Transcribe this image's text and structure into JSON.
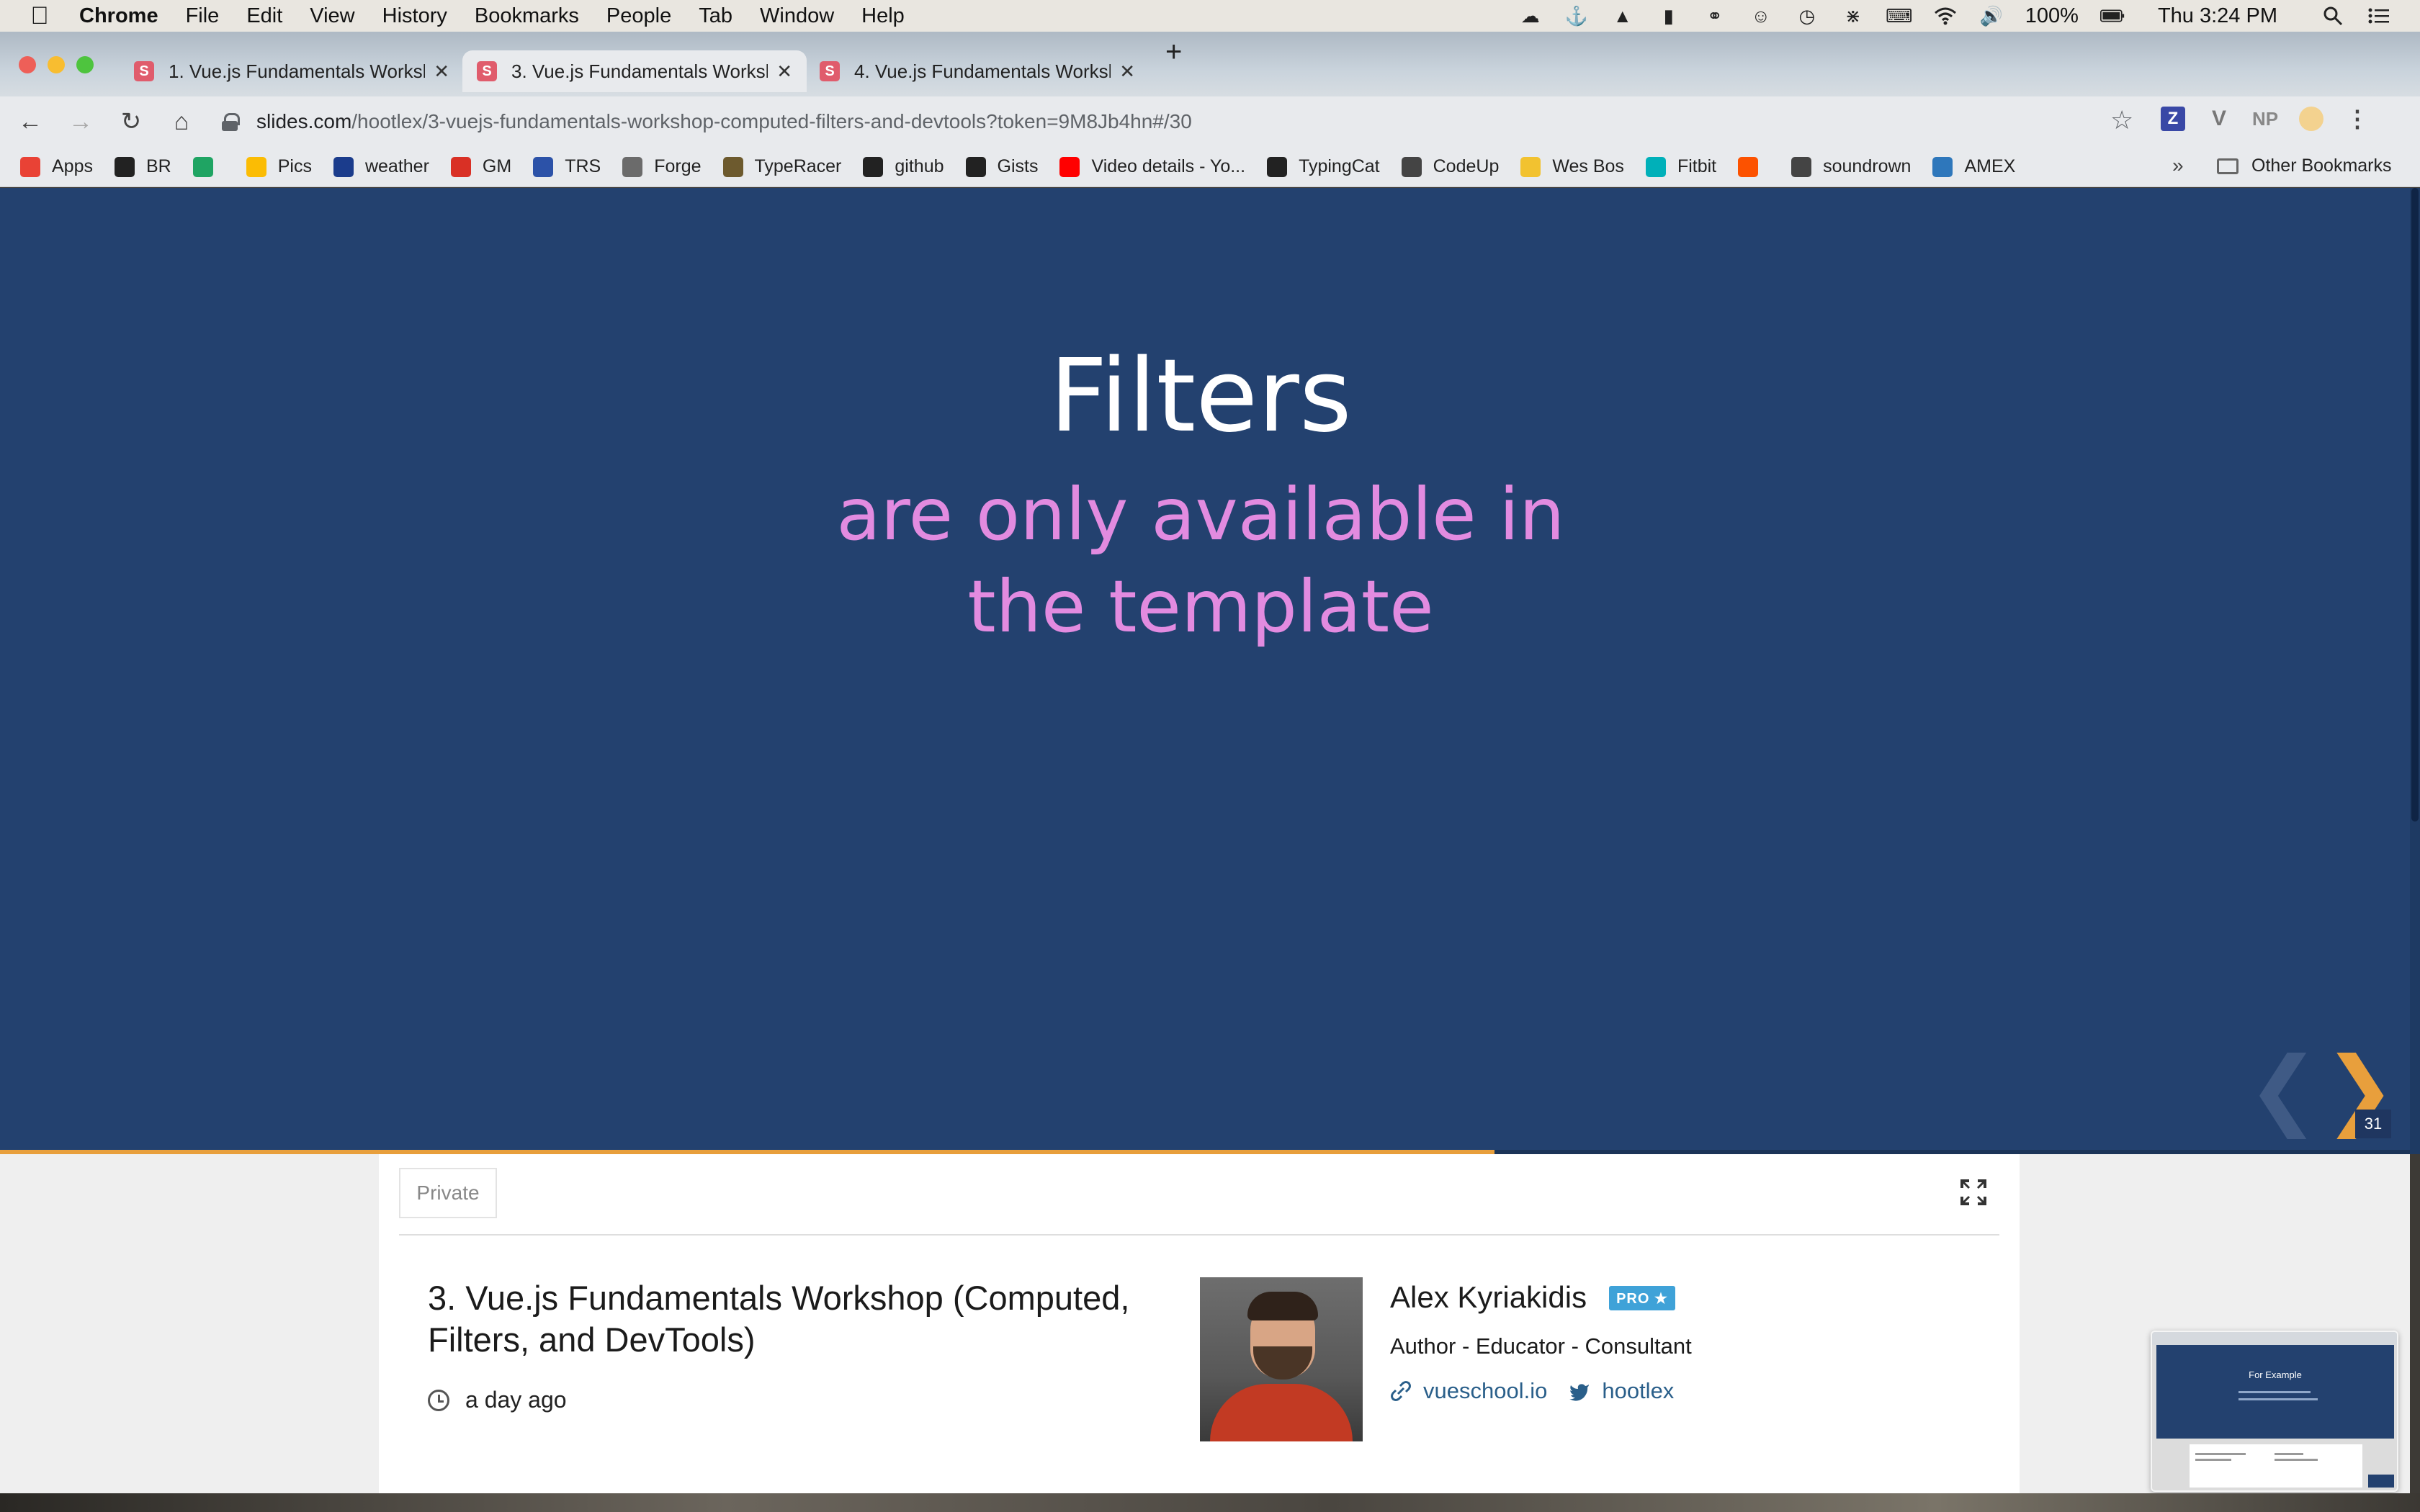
{
  "menubar": {
    "app_name": "Chrome",
    "items": [
      "File",
      "Edit",
      "View",
      "History",
      "Bookmarks",
      "People",
      "Tab",
      "Window",
      "Help"
    ],
    "battery": "100%",
    "clock": "Thu 3:24 PM",
    "status_icons": [
      "creative-cloud-icon",
      "docker-icon",
      "vectorworks-icon",
      "istat-icon",
      "glasses-icon",
      "accessibility-icon",
      "time-machine-icon",
      "bluetooth-icon",
      "keyboard-icon",
      "wifi-icon",
      "volume-icon"
    ]
  },
  "tabs": [
    {
      "title": "1. Vue.js Fundamentals Worksh",
      "active": false
    },
    {
      "title": "3. Vue.js Fundamentals Worksh",
      "active": true
    },
    {
      "title": "4. Vue.js Fundamentals Worksh",
      "active": false
    }
  ],
  "toolbar": {
    "url_host": "slides.com",
    "url_path": "/hootlex/3-vuejs-fundamentals-workshop-computed-filters-and-devtools?token=9M8Jb4hn#/30"
  },
  "extensions": {
    "z_label": "Z",
    "v_label": "V",
    "np_label": "NP"
  },
  "bookmarks": {
    "items": [
      {
        "label": "Apps",
        "icon": "apps-grid-icon",
        "color": "#e94235"
      },
      {
        "label": "BR",
        "icon": "github-icon",
        "color": "#222222"
      },
      {
        "label": "",
        "icon": "google-drive-icon",
        "color": "#1fa463"
      },
      {
        "label": "Pics",
        "icon": "google-photos-icon",
        "color": "#fbbc04"
      },
      {
        "label": "weather",
        "icon": "weather-channel-icon",
        "color": "#1b3c8c"
      },
      {
        "label": "GM",
        "icon": "gmail-icon",
        "color": "#d93025"
      },
      {
        "label": "TRS",
        "icon": "trs-icon",
        "color": "#2c52a8"
      },
      {
        "label": "Forge",
        "icon": "forge-icon",
        "color": "#6b6b6b"
      },
      {
        "label": "TypeRacer",
        "icon": "typeracer-icon",
        "color": "#6d5a2e"
      },
      {
        "label": "github",
        "icon": "github-icon",
        "color": "#222222"
      },
      {
        "label": "Gists",
        "icon": "github-icon",
        "color": "#222222"
      },
      {
        "label": "Video details - Yo...",
        "icon": "youtube-icon",
        "color": "#ff0000"
      },
      {
        "label": "TypingCat",
        "icon": "paw-icon",
        "color": "#222222"
      },
      {
        "label": "CodeUp",
        "icon": "globe-icon",
        "color": "#444444"
      },
      {
        "label": "Wes Bos",
        "icon": "crown-icon",
        "color": "#f2c230"
      },
      {
        "label": "Fitbit",
        "icon": "fitbit-icon",
        "color": "#00b0b9"
      },
      {
        "label": "",
        "icon": "strava-icon",
        "color": "#fc5200"
      },
      {
        "label": "soundrown",
        "icon": "globe-icon",
        "color": "#444444"
      },
      {
        "label": "AMEX",
        "icon": "amex-icon",
        "color": "#2e77bb"
      }
    ],
    "more": "»",
    "other": "Other Bookmarks"
  },
  "slide": {
    "title": "Filters",
    "subtitle": "are only available in the template",
    "slide_number": "31",
    "progress": 0.62
  },
  "deck": {
    "privacy": "Private",
    "title": "3. Vue.js Fundamentals Workshop (Computed, Filters, and DevTools)",
    "time_ago": "a day ago"
  },
  "author": {
    "name": "Alex Kyriakidis",
    "badge": "PRO ★",
    "role": "Author - Educator - Consultant",
    "website": "vueschool.io",
    "twitter": "hootlex"
  },
  "thumbnail": {
    "title": "For Example"
  },
  "colors": {
    "slide_bg": "#23416f",
    "slide_subtitle": "#e28be0",
    "accent_orange": "#e89f3c",
    "link_blue": "#2a5f8a",
    "pro_badge": "#3fa2d8"
  }
}
